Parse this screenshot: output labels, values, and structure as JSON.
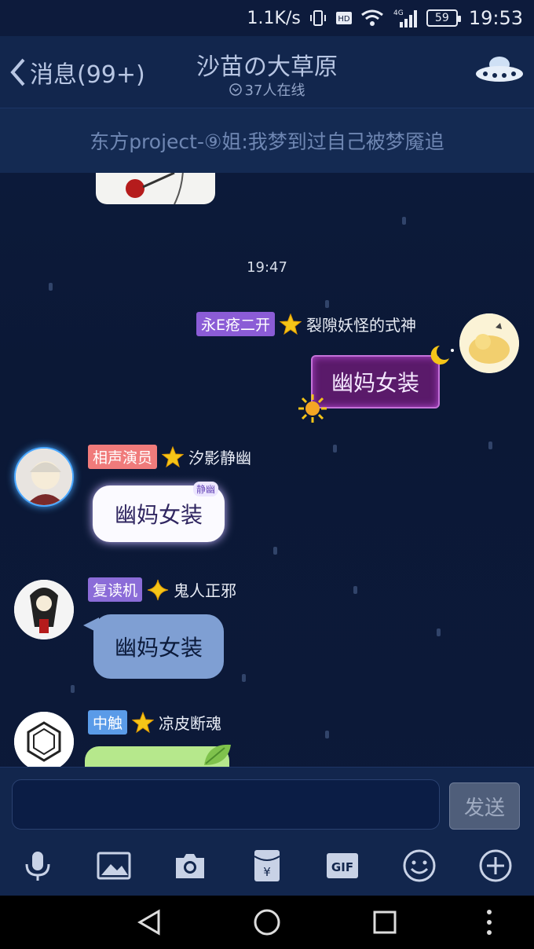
{
  "status_bar": {
    "net_speed": "1.1K/s",
    "network": "4G",
    "battery": "59",
    "time": "19:53"
  },
  "header": {
    "back_label": "消息(99+)",
    "title": "沙苗の大草原",
    "online": "37人在线"
  },
  "announcement": "东方project-⑨姐:我梦到过自己被梦魇追",
  "chat": {
    "timestamp": "19:47",
    "messages": [
      {
        "badge": "永E疮二开",
        "badge_color": "#8b5cd6",
        "name": "裂隙妖怪的式神",
        "text": "幽妈女装",
        "side": "right",
        "style": "purple"
      },
      {
        "badge": "相声演员",
        "badge_color": "#f07b7b",
        "name": "汐影静幽",
        "text": "幽妈女装",
        "side": "left",
        "style": "white",
        "tag": "静幽"
      },
      {
        "badge": "复读机",
        "badge_color": "#8b6cd8",
        "name": "鬼人正邪",
        "text": "幽妈女装",
        "side": "left",
        "style": "blue"
      },
      {
        "badge": "中触",
        "badge_color": "#5a9be8",
        "name": "凉皮断魂",
        "text": "",
        "side": "left",
        "style": "green"
      }
    ]
  },
  "input": {
    "placeholder": "",
    "send_label": "发送"
  },
  "toolbar": [
    "mic-icon",
    "image-icon",
    "camera-icon",
    "red-packet-icon",
    "gif-icon",
    "emoji-icon",
    "plus-icon"
  ],
  "toolbar_gif_label": "GIF",
  "navbar": [
    "back-triangle-icon",
    "home-circle-icon",
    "recents-square-icon",
    "more-dots-icon"
  ]
}
